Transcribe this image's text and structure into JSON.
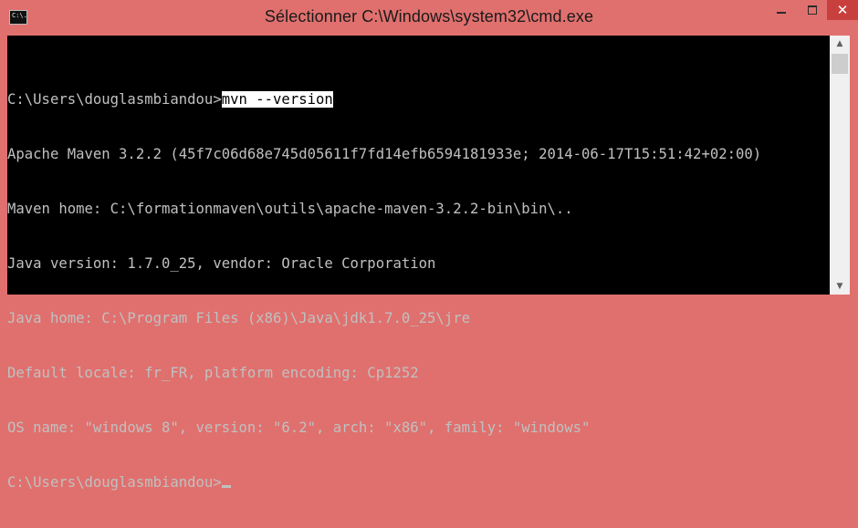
{
  "window": {
    "title": "Sélectionner C:\\Windows\\system32\\cmd.exe",
    "icon_label": "C:\\.",
    "controls": {
      "minimize_icon": "minimize-icon",
      "maximize_icon": "maximize-icon",
      "close_glyph": "✕"
    },
    "colors": {
      "frame": "#e0706e",
      "close_button": "#c8403d",
      "console_bg": "#000000",
      "console_text": "#c0c0c0",
      "selection_bg": "#ffffff"
    }
  },
  "console": {
    "prompt": "C:\\Users\\douglasmbiandou>",
    "selected_command": "mvn --version",
    "output": [
      "Apache Maven 3.2.2 (45f7c06d68e745d05611f7fd14efb6594181933e; 2014-06-17T15:51:42+02:00)",
      "Maven home: C:\\formationmaven\\outils\\apache-maven-3.2.2-bin\\bin\\..",
      "Java version: 1.7.0_25, vendor: Oracle Corporation",
      "Java home: C:\\Program Files (x86)\\Java\\jdk1.7.0_25\\jre",
      "Default locale: fr_FR, platform encoding: Cp1252",
      "OS name: \"windows 8\", version: \"6.2\", arch: \"x86\", family: \"windows\""
    ],
    "final_prompt": "C:\\Users\\douglasmbiandou>"
  },
  "scrollbar": {
    "up_glyph": "▲",
    "down_glyph": "▼"
  }
}
